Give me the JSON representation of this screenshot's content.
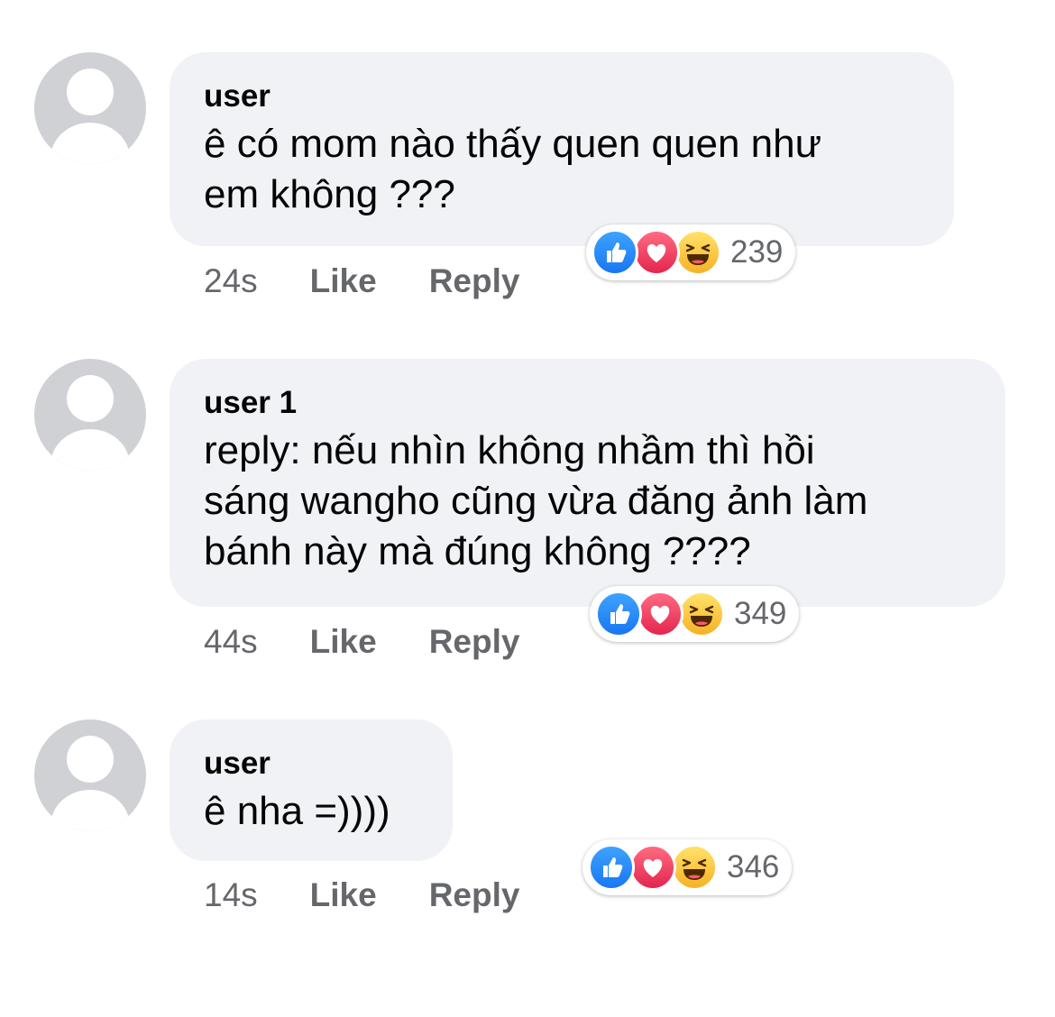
{
  "comments": [
    {
      "author": "user",
      "text": "ê có mom nào thấy quen quen như\nem không ???",
      "time": "24s",
      "like_label": "Like",
      "reply_label": "Reply",
      "reactions": [
        "like-icon",
        "love-icon",
        "haha-icon"
      ],
      "reaction_count": "239"
    },
    {
      "author": "user 1",
      "text": "reply: nếu nhìn không nhầm thì hồi\nsáng wangho cũng vừa đăng ảnh làm\nbánh này mà đúng không ????",
      "time": "44s",
      "like_label": "Like",
      "reply_label": "Reply",
      "reactions": [
        "like-icon",
        "love-icon",
        "haha-icon"
      ],
      "reaction_count": "349"
    },
    {
      "author": "user",
      "text": "ê nha =))))",
      "time": "14s",
      "like_label": "Like",
      "reply_label": "Reply",
      "reactions": [
        "like-icon",
        "love-icon",
        "haha-icon"
      ],
      "reaction_count": "346"
    }
  ],
  "colors": {
    "bubble": "#f0f2f5",
    "meta_text": "#65676b",
    "like_blue": "#1877f2",
    "love_red": "#e4254f",
    "haha_yellow": "#f7b125"
  }
}
